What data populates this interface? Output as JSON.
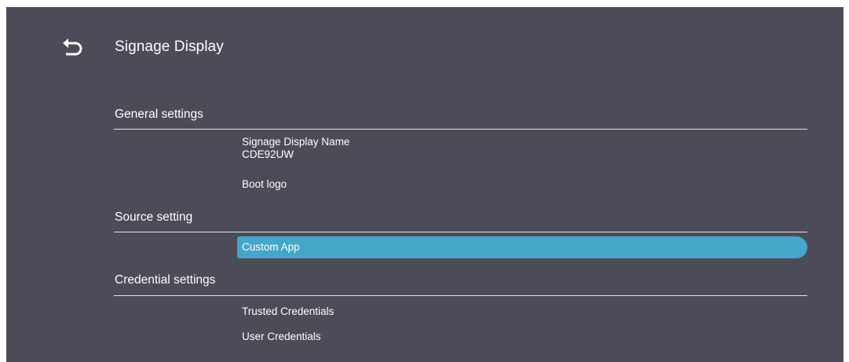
{
  "header": {
    "title": "Signage Display"
  },
  "sections": [
    {
      "title": "General settings",
      "items": [
        {
          "label": "Signage Display Name",
          "value": "CDE92UW"
        },
        {
          "label": "Boot logo"
        }
      ]
    },
    {
      "title": "Source setting",
      "items": [
        {
          "label": "Custom App",
          "selected": true
        }
      ]
    },
    {
      "title": "Credential settings",
      "items": [
        {
          "label": "Trusted Credentials"
        },
        {
          "label": "User Credentials"
        }
      ]
    }
  ],
  "colors": {
    "background": "#4b4c57",
    "highlight": "#44a7c9",
    "divider": "#e4e4e8",
    "text": "#ffffff"
  },
  "icons": {
    "back": "back-arrow-icon"
  }
}
